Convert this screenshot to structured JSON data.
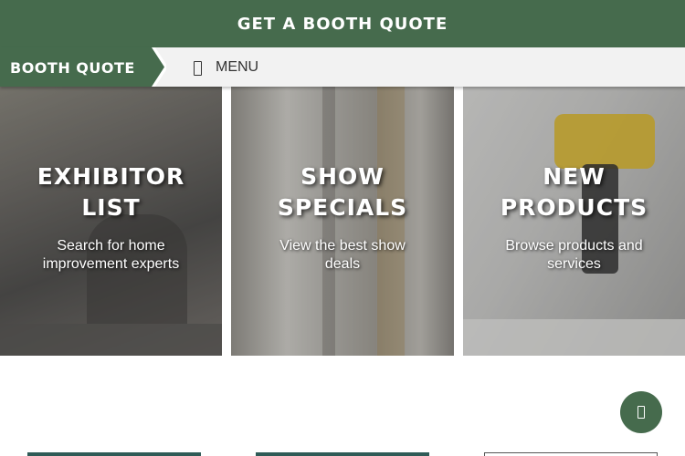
{
  "topbar": {
    "title": "GET A BOOTH QUOTE"
  },
  "navbar": {
    "brand": "BOOTH QUOTE",
    "menu_label": "MENU",
    "menu_icon": "menu-icon"
  },
  "tiles": [
    {
      "title_line1": "EXHIBITOR",
      "title_line2": "LIST",
      "subtitle_line1": "Search for home",
      "subtitle_line2": "improvement experts"
    },
    {
      "title_line1": "SHOW",
      "title_line2": "SPECIALS",
      "subtitle_line1": "View the best show",
      "subtitle_line2": "deals"
    },
    {
      "title_line1": "NEW",
      "title_line2": "PRODUCTS",
      "subtitle_line1": "Browse products and",
      "subtitle_line2": "services"
    }
  ],
  "fab": {
    "icon": "scroll-icon"
  },
  "colors": {
    "brand_green": "#466b4d",
    "card_teal": "#2f5b57",
    "navbar_bg": "#f2f2f2"
  }
}
